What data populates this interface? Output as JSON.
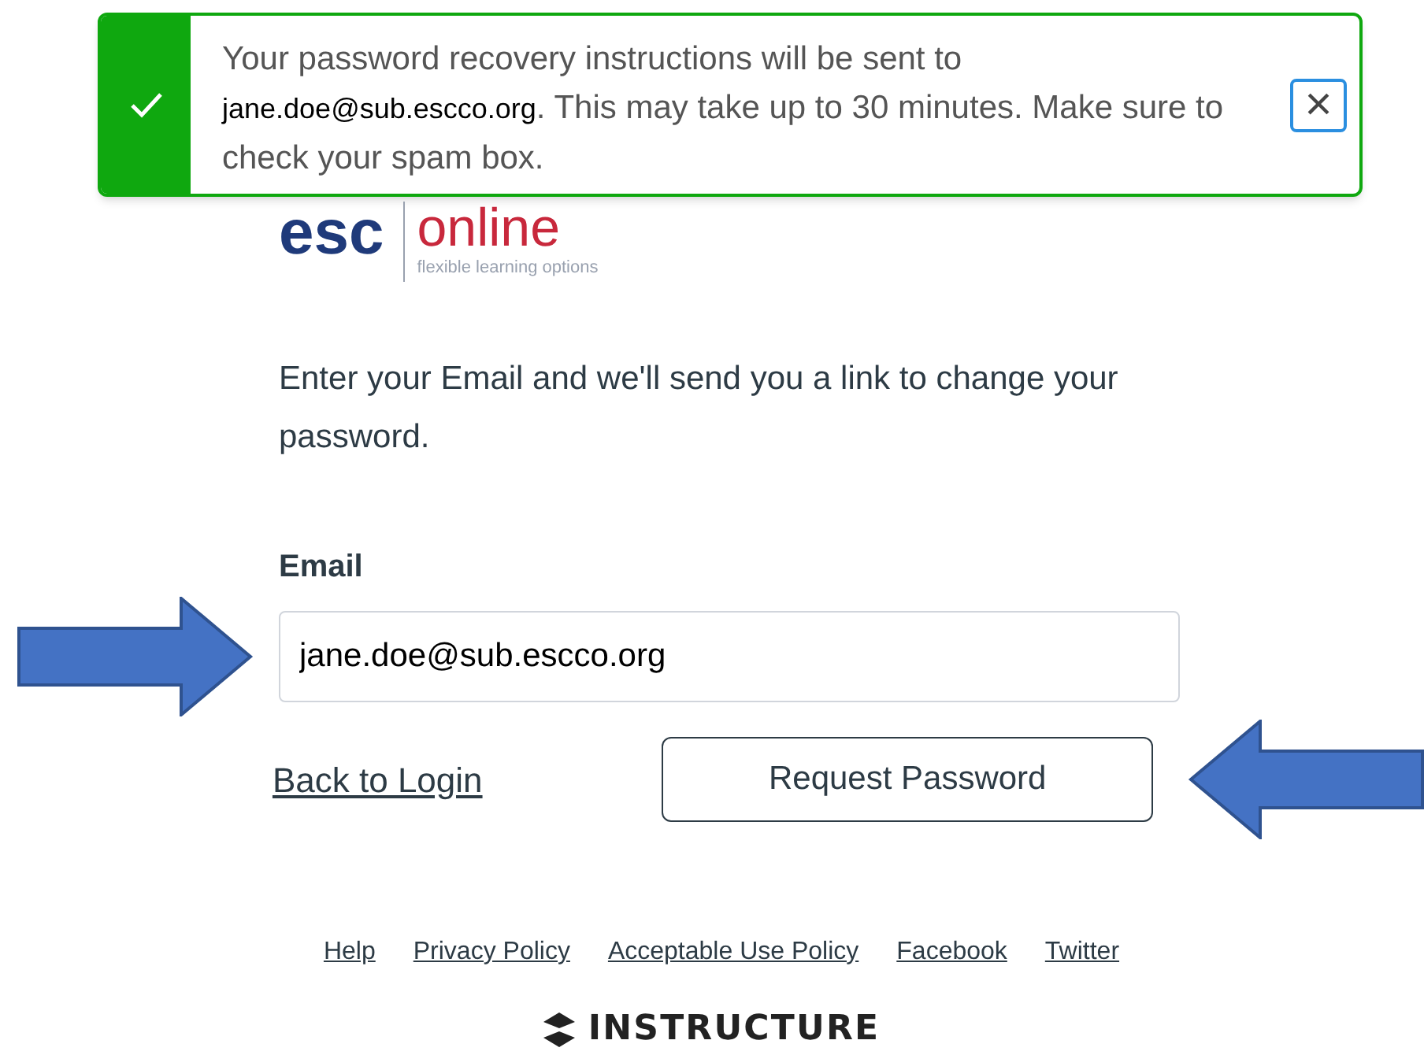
{
  "toast": {
    "message_start": "Your password recovery instructions will be sent to",
    "email": "jane.doe@sub.escco.org",
    "message_end": ". This may take up to 30 minutes. Make sure to check your spam box.",
    "close_glyph": "×"
  },
  "logo": {
    "part_1": "esc",
    "part_2": "online",
    "tagline": "flexible learning options"
  },
  "instructions": "Enter your Email and we'll send you a link to change your password.",
  "email_field": {
    "label": "Email",
    "value": "jane.doe@sub.escco.org"
  },
  "back_link": "Back to Login",
  "submit_button": "Request Password",
  "footer_links": [
    "Help",
    "Privacy Policy",
    "Acceptable Use Policy",
    "Facebook",
    "Twitter"
  ],
  "brand": "INSTRUCTURE"
}
